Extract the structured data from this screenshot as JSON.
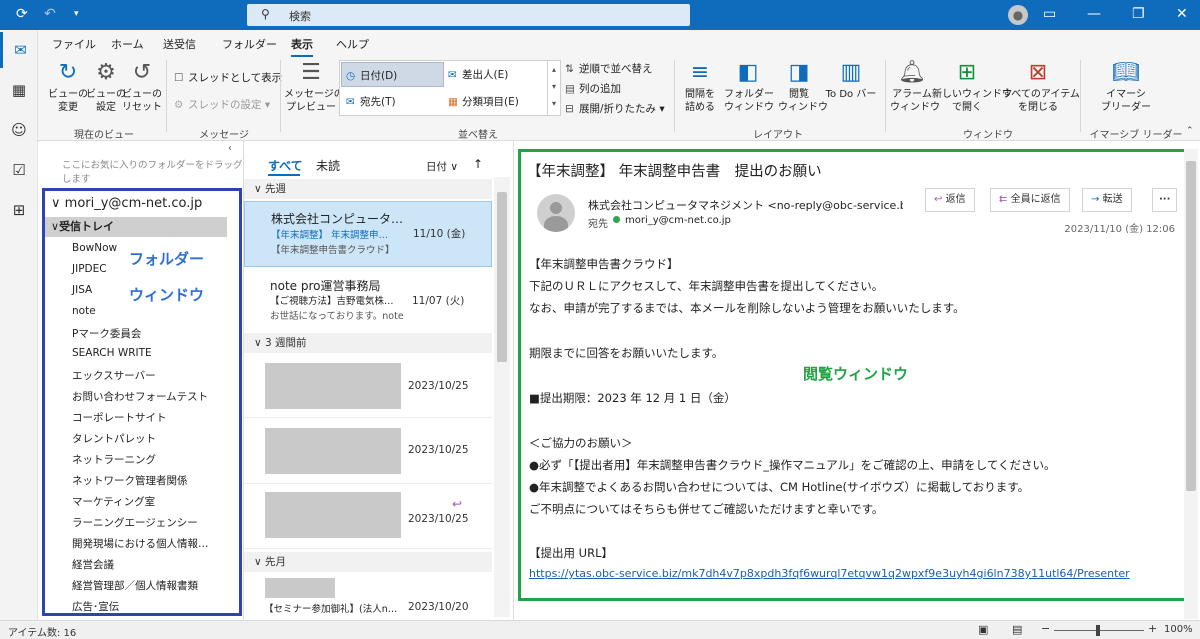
{
  "titlebar": {
    "search_placeholder": "検索"
  },
  "ribbon": {
    "tabs": [
      "ファイル",
      "ホーム",
      "送受信",
      "フォルダー",
      "表示",
      "ヘルプ"
    ],
    "current_view": {
      "view_change": "ビューの\n変更",
      "view_settings": "ビューの\n設定",
      "view_reset": "ビューの\nリセット",
      "group": "現在のビュー"
    },
    "messages": {
      "thread_label": "スレッドとして表示",
      "thread_settings": "スレッドの設定",
      "group": "メッセージ"
    },
    "arrange": {
      "preview": "メッセージの\nプレビュー",
      "date": "日付(D)",
      "from": "差出人(E)",
      "to": "宛先(T)",
      "category": "分類項目(E)",
      "reverse": "逆順で並べ替え",
      "add_column": "列の追加",
      "expand": "展開/折りたたみ",
      "group": "並べ替え"
    },
    "layout": {
      "spacing": "間隔を\n詰める",
      "folder_pane": "フォルダー\nウィンドウ",
      "reading_pane": "閲覧\nウィンドウ",
      "todo": "To Do バー",
      "group": "レイアウト"
    },
    "window": {
      "reminder": "アラーム\nウィンドウ",
      "new_window": "新しいウィンドウ\nで開く",
      "close_all": "すべてのアイテム\nを閉じる",
      "group": "ウィンドウ"
    },
    "immersive": {
      "reader": "イマーシ\nブリーダー",
      "group": "イマーシブ リーダー"
    }
  },
  "folder_pane": {
    "hint": "ここにお気に入りのフォルダーをドラッグします",
    "account": "mori_y@cm-net.co.jp",
    "inbox": "受信トレイ",
    "folders": [
      "BowNow",
      "JIPDEC",
      "JISA",
      "note",
      "Pマーク委員会",
      "SEARCH WRITE",
      "エックスサーバー",
      "お問い合わせフォームテスト",
      "コーポレートサイト",
      "タレントパレット",
      "ネットラーニング",
      "ネットワーク管理者関係",
      "マーケティング室",
      "ラーニングエージェンシー",
      "開発現場における個人情報…",
      "経営会議",
      "経営管理部／個人情報書類",
      "広告･宣伝"
    ],
    "annotation_line1": "フォルダー",
    "annotation_line2": "ウィンドウ"
  },
  "message_list": {
    "tab_all": "すべて",
    "tab_unread": "未読",
    "sort_label": "日付",
    "sections": {
      "last_week": "先週",
      "three_weeks": "3 週間前",
      "last_month": "先月"
    },
    "items": [
      {
        "from": "株式会社コンピュータ…",
        "subject": "【年末調整】 年末調整申…",
        "preview": "【年末調整申告書クラウド】",
        "date": "11/10 (金)"
      },
      {
        "from": "note pro運営事務局",
        "subject": "【ご視聴方法】吉野電気株…",
        "preview": "お世話になっております。note",
        "date": "11/07 (火)"
      },
      {
        "date": "2023/10/25"
      },
      {
        "date": "2023/10/25"
      },
      {
        "date": "2023/10/25"
      },
      {
        "subject": "【セミナー参加御礼】(法人n…",
        "date": "2023/10/20"
      }
    ]
  },
  "reading_pane": {
    "subject": "【年末調整】 年末調整申告書　提出のお願い",
    "from": "株式会社コンピュータマネジメント <no-reply@obc-service.biz>",
    "to_label": "宛先",
    "to": "mori_y@cm-net.co.jp",
    "reply": "返信",
    "reply_all": "全員に返信",
    "forward": "転送",
    "date": "2023/11/10 (金) 12:06",
    "body": {
      "l1": "【年末調整申告書クラウド】",
      "l2": "下記のＵＲＬにアクセスして、年末調整申告書を提出してください。",
      "l3": "なお、申請が完了するまでは、本メールを削除しないよう管理をお願いいたします。",
      "l4": "期限までに回答をお願いいたします。",
      "l5": "■提出期限：2023 年 12 月 1 日（金）",
      "l6": "＜ご協力のお願い＞",
      "l7": "●必ず「【提出者用】年末調整申告書クラウド_操作マニュアル」をご確認の上、申請をしてください。",
      "l8": "●年末調整でよくあるお問い合わせについては、CM Hotline(サイボウズ）に掲載しております。",
      "l9": "ご不明点についてはそちらも併せてご確認いただけますと幸いです。",
      "l10": "【提出用 URL】",
      "link": "https://ytas.obc-service.biz/mk7dh4v7p8xpdh3fqf6wurql7etqvw1q2wpxf9e3uyh4gi6ln738y11utl64/Presenter"
    },
    "annotation": "閲覧ウィンドウ"
  },
  "status": {
    "item_count": "アイテム数: 16",
    "zoom": "100%"
  }
}
